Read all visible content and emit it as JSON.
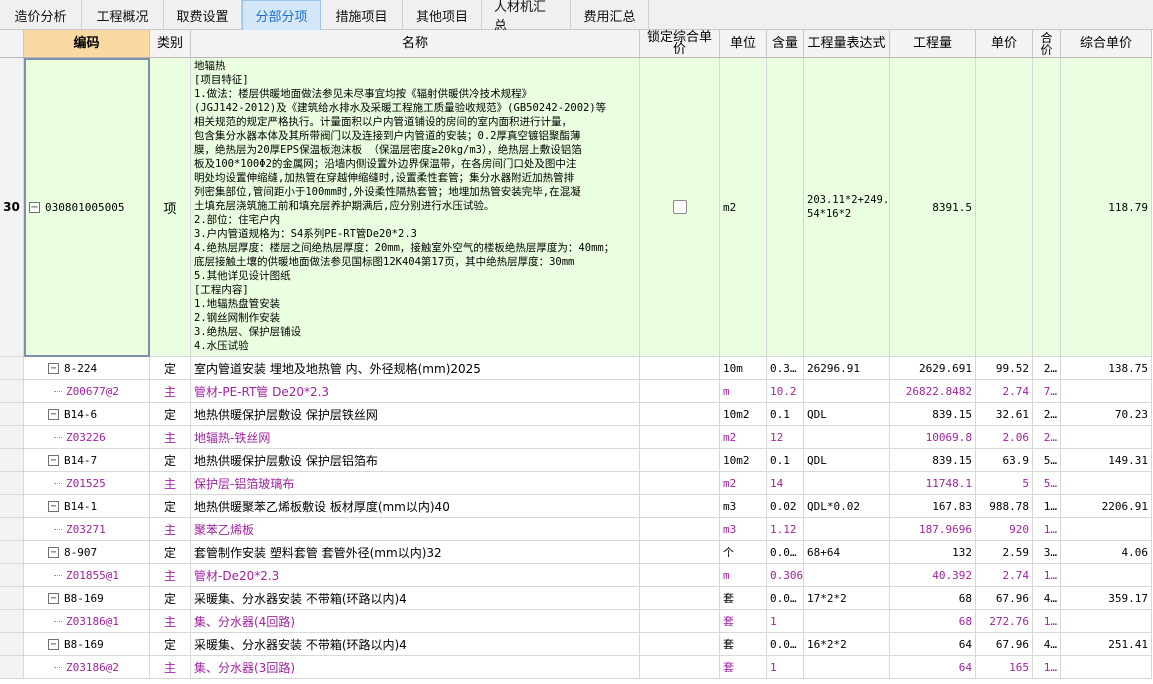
{
  "tabs": [
    {
      "label": "造价分析",
      "active": false
    },
    {
      "label": "工程概况",
      "active": false
    },
    {
      "label": "取费设置",
      "active": false
    },
    {
      "label": "分部分项",
      "active": true
    },
    {
      "label": "措施项目",
      "active": false
    },
    {
      "label": "其他项目",
      "active": false
    },
    {
      "label": "人材机汇总",
      "active": false
    },
    {
      "label": "费用汇总",
      "active": false
    }
  ],
  "columns": {
    "code": "编码",
    "type": "类别",
    "name": "名称",
    "lock": "锁定综合单价",
    "unit": "单位",
    "content": "含量",
    "expr": "工程量表达式",
    "qty": "工程量",
    "price": "单价",
    "total": "合价",
    "unit_total": "综合单价"
  },
  "main_item": {
    "row_number": "30",
    "code": "030801005005",
    "type": "项",
    "name_lines": [
      "地辐热",
      "[项目特征]",
      "1.做法：楼层供暖地面做法参见未尽事宜均按《辐射供暖供冷技术规程》",
      "(JGJ142-2012)及《建筑给水排水及采暖工程施工质量验收规范》(GB50242-2002)等",
      "相关规范的规定严格执行。计量面积以户内管道铺设的房间的室内面积进行计量，",
      "包含集分水器本体及其所带阀门以及连接到户内管道的安装；0.2厚真空镀铝聚酯薄",
      "膜，绝热层为20厚EPS保温板泡沫板 （保温层密度≥20kg/m3），绝热层上敷设铝箔",
      "板及100*100Φ2的金属网；沿墙内侧设置外边界保温带，在各房间门口处及图中注",
      "明处均设置伸缩缝,加热管在穿越伸缩缝时,设置柔性套管；集分水器附近加热管排",
      "列密集部位,管间距小于100mm时,外设柔性隔热套管；地埋加热管安装完毕,在混凝",
      "土填充层浇筑施工前和填充层养护期满后,应分别进行水压试验。",
      "2.部位：住宅户内",
      "3.户内管道规格为：S4系列PE-RT管De20*2.3",
      "4.绝热层厚度：楼层之间绝热层厚度：20mm，接触室外空气的楼板绝热层厚度为：40mm；",
      "底层接触土壤的供暖地面做法参见国标图12K404第17页，其中绝热层厚度：30mm",
      "5.其他详见设计图纸",
      "[工程内容]",
      "1.地辐热盘管安装",
      "2.钢丝网制作安装",
      "3.绝热层、保护层铺设",
      "4.水压试验"
    ],
    "unit": "m2",
    "expr_lines": [
      "203.11*2+249.",
      "54*16*2"
    ],
    "qty": "8391.5",
    "unit_total": "118.79"
  },
  "rows": [
    {
      "kind": "quota",
      "code": "8-224",
      "type": "定",
      "name": "室内管道安装 埋地及地热管 内、外径规格(mm)2025",
      "unit": "10m",
      "content": "0.3…",
      "expr": "26296.91",
      "qty": "2629.691",
      "price": "99.52",
      "total": "2…",
      "unit_total": "138.75"
    },
    {
      "kind": "main",
      "code": "Z00677@2",
      "type": "主",
      "name": "管材-PE-RT管 De20*2.3",
      "unit": "m",
      "content": "10.2",
      "expr": "",
      "qty": "26822.8482",
      "price": "2.74",
      "total": "7…",
      "unit_total": ""
    },
    {
      "kind": "quota",
      "code": "B14-6",
      "type": "定",
      "name": "地热供暖保护层敷设 保护层铁丝网",
      "unit": "10m2",
      "content": "0.1",
      "expr": "QDL",
      "qty": "839.15",
      "price": "32.61",
      "total": "2…",
      "unit_total": "70.23"
    },
    {
      "kind": "main",
      "code": "Z03226",
      "type": "主",
      "name": "地辐热-铁丝网",
      "unit": "m2",
      "content": "12",
      "expr": "",
      "qty": "10069.8",
      "price": "2.06",
      "total": "2…",
      "unit_total": ""
    },
    {
      "kind": "quota",
      "code": "B14-7",
      "type": "定",
      "name": "地热供暖保护层敷设 保护层铝箔布",
      "unit": "10m2",
      "content": "0.1",
      "expr": "QDL",
      "qty": "839.15",
      "price": "63.9",
      "total": "5…",
      "unit_total": "149.31"
    },
    {
      "kind": "main",
      "code": "Z01525",
      "type": "主",
      "name": "保护层-铝箔玻璃布",
      "unit": "m2",
      "content": "14",
      "expr": "",
      "qty": "11748.1",
      "price": "5",
      "total": "5…",
      "unit_total": ""
    },
    {
      "kind": "quota",
      "code": "B14-1",
      "type": "定",
      "name": "地热供暖聚苯乙烯板敷设 板材厚度(mm以内)40",
      "unit": "m3",
      "content": "0.02",
      "expr": "QDL*0.02",
      "qty": "167.83",
      "price": "988.78",
      "total": "1…",
      "unit_total": "2206.91"
    },
    {
      "kind": "main",
      "code": "Z03271",
      "type": "主",
      "name": "聚苯乙烯板",
      "unit": "m3",
      "content": "1.12",
      "expr": "",
      "qty": "187.9696",
      "price": "920",
      "total": "1…",
      "unit_total": ""
    },
    {
      "kind": "quota",
      "code": "8-907",
      "type": "定",
      "name": "套管制作安装 塑料套管 套管外径(mm以内)32",
      "unit": "个",
      "content": "0.0…",
      "expr": "68+64",
      "qty": "132",
      "price": "2.59",
      "total": "3…",
      "unit_total": "4.06"
    },
    {
      "kind": "main",
      "code": "Z01855@1",
      "type": "主",
      "name": "管材-De20*2.3",
      "unit": "m",
      "content": "0.306",
      "expr": "",
      "qty": "40.392",
      "price": "2.74",
      "total": "1…",
      "unit_total": ""
    },
    {
      "kind": "quota",
      "code": "B8-169",
      "type": "定",
      "name": "采暖集、分水器安装 不带箱(环路以内)4",
      "unit": "套",
      "content": "0.0…",
      "expr": "17*2*2",
      "qty": "68",
      "price": "67.96",
      "total": "4…",
      "unit_total": "359.17"
    },
    {
      "kind": "main",
      "code": "Z03186@1",
      "type": "主",
      "name": "集、分水器(4回路)",
      "unit": "套",
      "content": "1",
      "expr": "",
      "qty": "68",
      "price": "272.76",
      "total": "1…",
      "unit_total": ""
    },
    {
      "kind": "quota",
      "code": "B8-169",
      "type": "定",
      "name": "采暖集、分水器安装 不带箱(环路以内)4",
      "unit": "套",
      "content": "0.0…",
      "expr": "16*2*2",
      "qty": "64",
      "price": "67.96",
      "total": "4…",
      "unit_total": "251.41"
    },
    {
      "kind": "main",
      "code": "Z03186@2",
      "type": "主",
      "name": "集、分水器(3回路)",
      "unit": "套",
      "content": "1",
      "expr": "",
      "qty": "64",
      "price": "165",
      "total": "1…",
      "unit_total": ""
    }
  ],
  "colors": {
    "main_material_text": "#a0249f",
    "selected_item_bg": "#eaffdf",
    "code_header_bg": "#fbd9a3",
    "active_tab_text": "#1b6fc8"
  }
}
